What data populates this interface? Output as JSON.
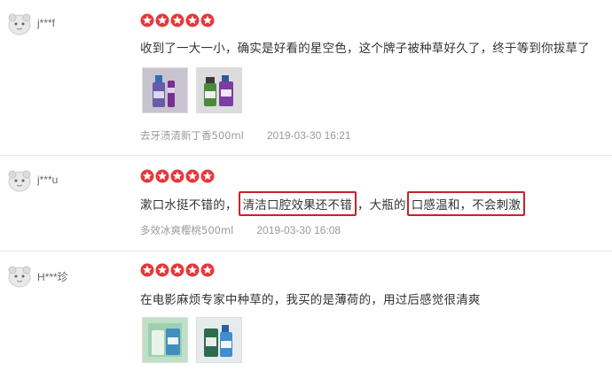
{
  "reviews": [
    {
      "user": "j***f",
      "rating": 5,
      "text": "收到了一大一小，确实是好看的星空色，这个牌子被种草好久了，终于等到你拔草了",
      "sku": "去牙渍清新丁香500ml",
      "date": "2019-03-30 16:21"
    },
    {
      "user": "j***u",
      "rating": 5,
      "text_parts": [
        "漱口水挺不错的，",
        "清洁口腔效果还不错",
        "，大瓶的",
        "口感温和，不会刺激"
      ],
      "sku": "多效冰爽樱桃500ml",
      "date": "2019-03-30 16:08"
    },
    {
      "user": "H***珍",
      "rating": 5,
      "text": "在电影麻烦专家中种草的，我买的是薄荷的，用过后感觉很清爽"
    }
  ],
  "colors": {
    "star": "#e4393c",
    "highlight_border": "#c6242a",
    "meta_text": "#9a9a9a",
    "divider": "#e6e6e6"
  }
}
